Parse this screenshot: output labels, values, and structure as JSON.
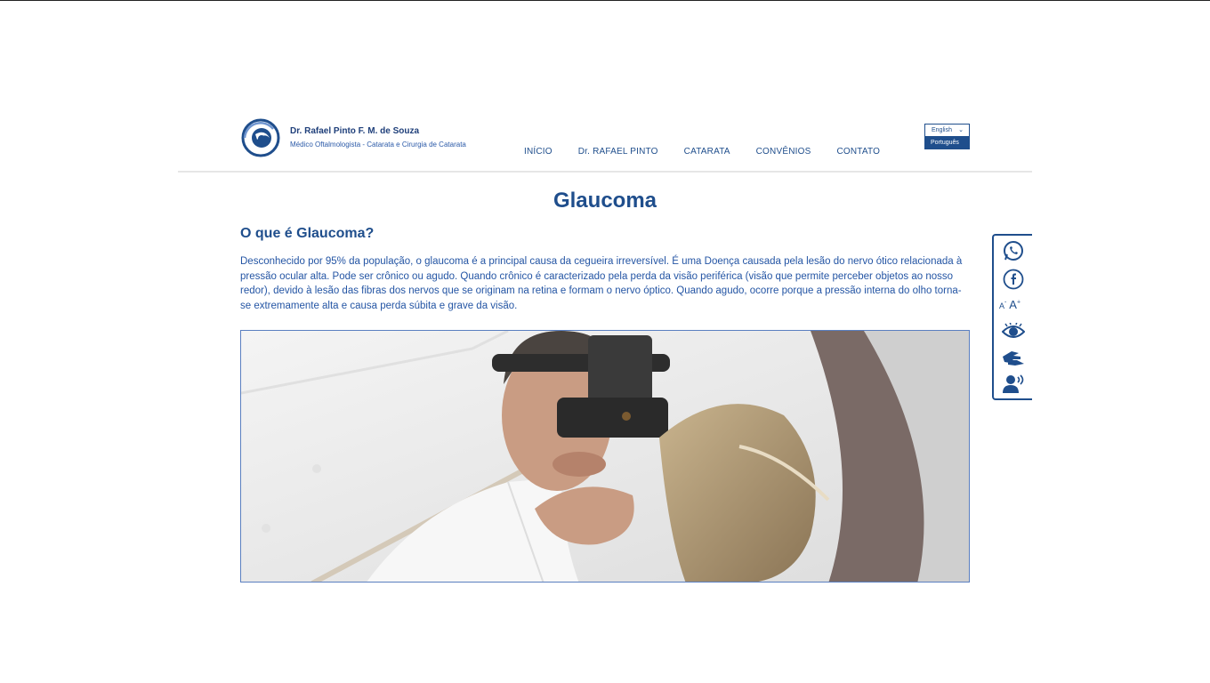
{
  "brand": {
    "name": "Dr. Rafael Pinto F. M. de Souza",
    "subtitle": "Médico Oftalmologista - Catarata e Cirurgia de Catarata"
  },
  "nav": {
    "items": [
      "INÍCIO",
      "Dr. RAFAEL PINTO",
      "CATARATA",
      "CONVÊNIOS",
      "CONTATO"
    ]
  },
  "language": {
    "selected": "English",
    "options": [
      "Português"
    ]
  },
  "page": {
    "title": "Glaucoma",
    "section_title": "O que é Glaucoma?",
    "body": "Desconhecido por 95% da população, o glaucoma é a principal causa da cegueira irreversível. É uma Doença causada pela lesão do nervo ótico relacionada à pressão ocular alta. Pode ser crônico ou agudo. Quando crônico é caracterizado pela perda da visão periférica (visão que permite perceber objetos ao nosso redor), devido à lesão das fibras dos nervos que se originam na retina e formam o nervo óptico. Quando agudo, ocorre porque a pressão interna do olho torna-se extremamente alta e causa perda súbita e grave da visão."
  },
  "accessibility": {
    "decrease_font": "A",
    "decrease_sign": "-",
    "increase_font": "A",
    "increase_sign": "+",
    "icons": [
      "whatsapp-icon",
      "facebook-icon",
      "font-size-icon",
      "contrast-eye-icon",
      "sign-language-icon",
      "screen-reader-icon"
    ]
  },
  "colors": {
    "primary": "#1f4e8c",
    "text": "#2455a4"
  }
}
